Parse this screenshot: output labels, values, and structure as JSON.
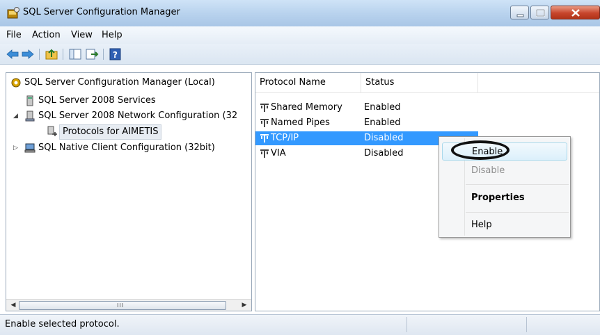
{
  "window": {
    "title": "SQL Server Configuration Manager"
  },
  "menu": {
    "items": [
      "File",
      "Action",
      "View",
      "Help"
    ]
  },
  "toolbar": {
    "icons": [
      "back-arrow-icon",
      "forward-arrow-icon",
      "up-folder-icon",
      "show-hide-tree-icon",
      "export-list-icon",
      "help-icon"
    ]
  },
  "tree": {
    "root": "SQL Server Configuration Manager (Local)",
    "items": [
      "SQL Server 2008 Services",
      "SQL Server 2008 Network Configuration (32",
      "Protocols for AIMETIS",
      "SQL Native Client Configuration (32bit)"
    ],
    "scroll_grip": "III"
  },
  "list": {
    "columns": [
      "Protocol Name",
      "Status"
    ],
    "rows": [
      {
        "name": "Shared Memory",
        "status": "Enabled"
      },
      {
        "name": "Named Pipes",
        "status": "Enabled"
      },
      {
        "name": "TCP/IP",
        "status": "Disabled"
      },
      {
        "name": "VIA",
        "status": "Disabled"
      }
    ]
  },
  "context_menu": {
    "items": [
      "Enable",
      "Disable",
      "Properties",
      "Help"
    ]
  },
  "status": {
    "text": "Enable selected protocol."
  },
  "colors": {
    "selection": "#3399ff",
    "titlebar": "#b9d3ee",
    "close_button": "#c7452c"
  }
}
